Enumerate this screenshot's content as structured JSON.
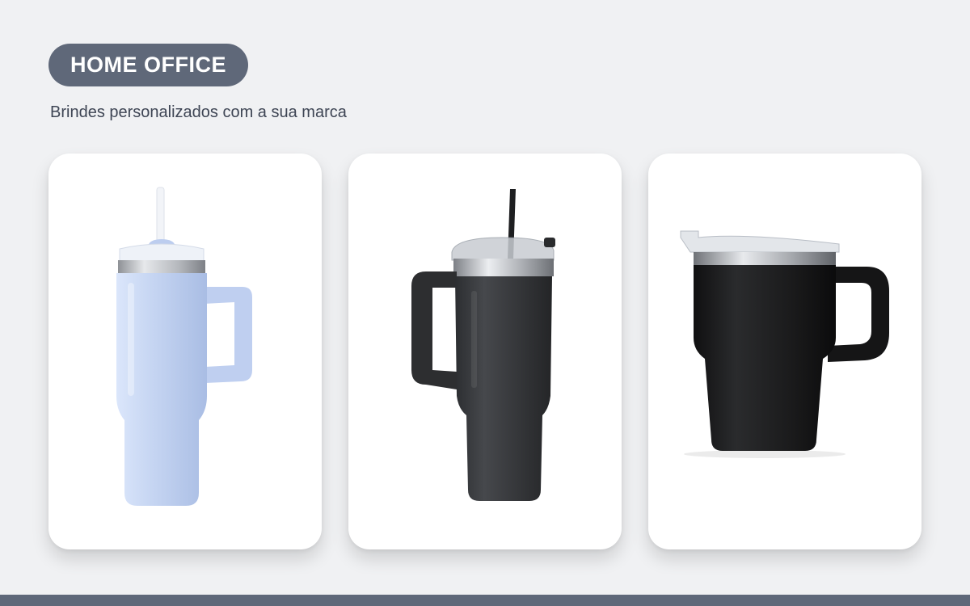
{
  "section": {
    "badge_label": "HOME OFFICE",
    "subtitle": "Brindes personalizados com a sua marca"
  },
  "products": [
    {
      "image": "light-blue-tumbler-with-straw",
      "color": "#c9d8f2"
    },
    {
      "image": "black-tumbler-with-straw",
      "color": "#3b3d40"
    },
    {
      "image": "black-insulated-mug-with-lid",
      "color": "#1b1b1c"
    }
  ],
  "colors": {
    "background": "#f0f1f3",
    "badge": "#5f6879",
    "card": "#ffffff"
  }
}
